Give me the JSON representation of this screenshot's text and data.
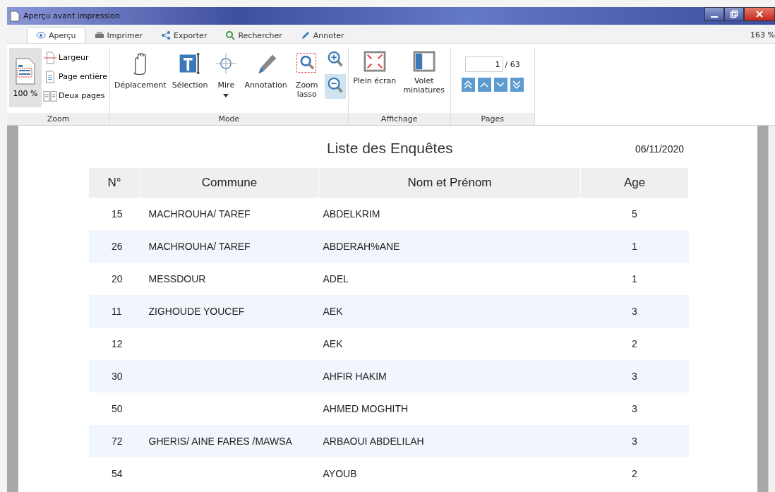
{
  "window": {
    "title": "Aperçu avant impression"
  },
  "tabs": [
    {
      "label": "Aperçu",
      "selected": true
    },
    {
      "label": "Imprimer",
      "selected": false
    },
    {
      "label": "Exporter",
      "selected": false
    },
    {
      "label": "Rechercher",
      "selected": false
    },
    {
      "label": "Annoter",
      "selected": false
    }
  ],
  "zoom_readout": "163 %",
  "ribbon": {
    "zoom": {
      "label": "Zoom",
      "big": {
        "label": "100 %",
        "selected": true
      },
      "small": [
        {
          "label": "Largeur"
        },
        {
          "label": "Page entière"
        },
        {
          "label": "Deux pages"
        }
      ]
    },
    "mode": {
      "label": "Mode",
      "buttons": [
        {
          "label": "Déplacement"
        },
        {
          "label": "Sélection"
        },
        {
          "label": "Mire"
        },
        {
          "label": "Annotation"
        },
        {
          "label": "Zoom lasso"
        }
      ],
      "zoom_buttons": [
        {
          "selected": false
        },
        {
          "selected": true
        }
      ]
    },
    "display": {
      "label": "Affichage",
      "buttons": [
        {
          "label": "Plein écran"
        },
        {
          "label": "Volet miniatures"
        }
      ]
    },
    "pages": {
      "label": "Pages",
      "current": "1",
      "total": "/ 63"
    }
  },
  "report": {
    "title": "Liste des Enquêtes",
    "date": "06/11/2020",
    "columns": [
      "N°",
      "Commune",
      "Nom et Prénom",
      "Age"
    ],
    "rows": [
      [
        "15",
        "MACHROUHA/ TAREF",
        "ABDELKRIM",
        "5"
      ],
      [
        "26",
        "MACHROUHA/ TAREF",
        "ABDERAH%ANE",
        "1"
      ],
      [
        "20",
        "MESSDOUR",
        "ADEL",
        "1"
      ],
      [
        "11",
        "ZIGHOUDE YOUCEF",
        "AEK",
        "3"
      ],
      [
        "12",
        "",
        "AEK",
        "2"
      ],
      [
        "30",
        "",
        "AHFIR HAKIM",
        "3"
      ],
      [
        "50",
        "",
        "AHMED MOGHITH",
        "3"
      ],
      [
        "72",
        "GHERIS/ AINE FARES /MAWSA",
        "ARBAOUI ABDELILAH",
        "3"
      ],
      [
        "54",
        "",
        "AYOUB",
        "2"
      ]
    ]
  }
}
